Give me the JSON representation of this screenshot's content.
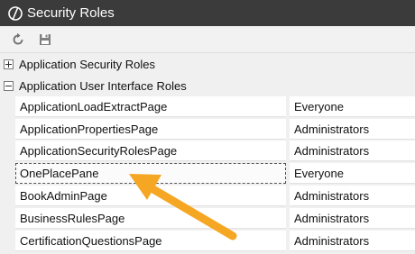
{
  "window": {
    "title": "Security Roles",
    "app_icon": "circle-slash-icon"
  },
  "toolbar": {
    "buttons": [
      {
        "name": "refresh",
        "icon": "refresh-icon"
      },
      {
        "name": "save",
        "icon": "floppy-disk-icon"
      }
    ]
  },
  "groups": [
    {
      "label": "Application Security Roles",
      "expanded": false
    },
    {
      "label": "Application User Interface Roles",
      "expanded": true
    }
  ],
  "rows": [
    {
      "name": "ApplicationLoadExtractPage",
      "role": "Everyone"
    },
    {
      "name": "ApplicationPropertiesPage",
      "role": "Administrators"
    },
    {
      "name": "ApplicationSecurityRolesPage",
      "role": "Administrators"
    },
    {
      "name": "OnePlacePane",
      "role": "Everyone",
      "focused": true
    },
    {
      "name": "BookAdminPage",
      "role": "Administrators"
    },
    {
      "name": "BusinessRulesPage",
      "role": "Administrators"
    },
    {
      "name": "CertificationQuestionsPage",
      "role": "Administrators"
    }
  ],
  "colors": {
    "titlebar": "#3b3b3b",
    "annotation_arrow": "#f5a623"
  }
}
